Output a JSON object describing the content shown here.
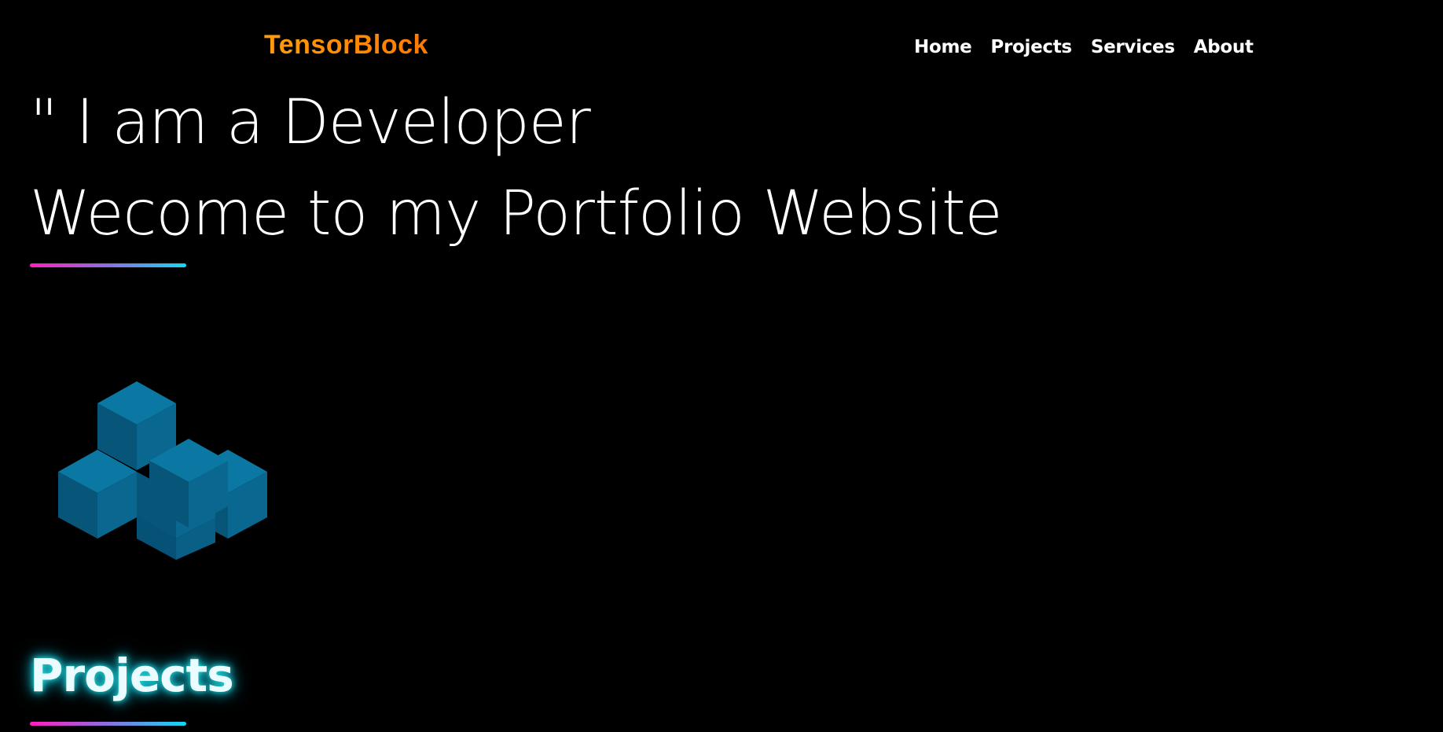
{
  "header": {
    "brand": "TensorBlock",
    "nav": [
      {
        "label": "Home"
      },
      {
        "label": "Projects"
      },
      {
        "label": "Services"
      },
      {
        "label": "About"
      }
    ]
  },
  "hero": {
    "line1": "\" I am a Developer",
    "line2": "Wecome to my Portfolio Website"
  },
  "projects": {
    "title": "Projects"
  },
  "colors": {
    "background": "#000000",
    "brand": "#ff8a00",
    "text": "#ffffff",
    "gradient_start": "#ff1fbf",
    "gradient_end": "#12d8f2",
    "block_top": "#0b78a3",
    "block_left": "#07567a",
    "block_right": "#0a6890",
    "glow": "#26e0e0"
  },
  "icons": {
    "hero_graphic": "isometric-blocks-icon"
  }
}
